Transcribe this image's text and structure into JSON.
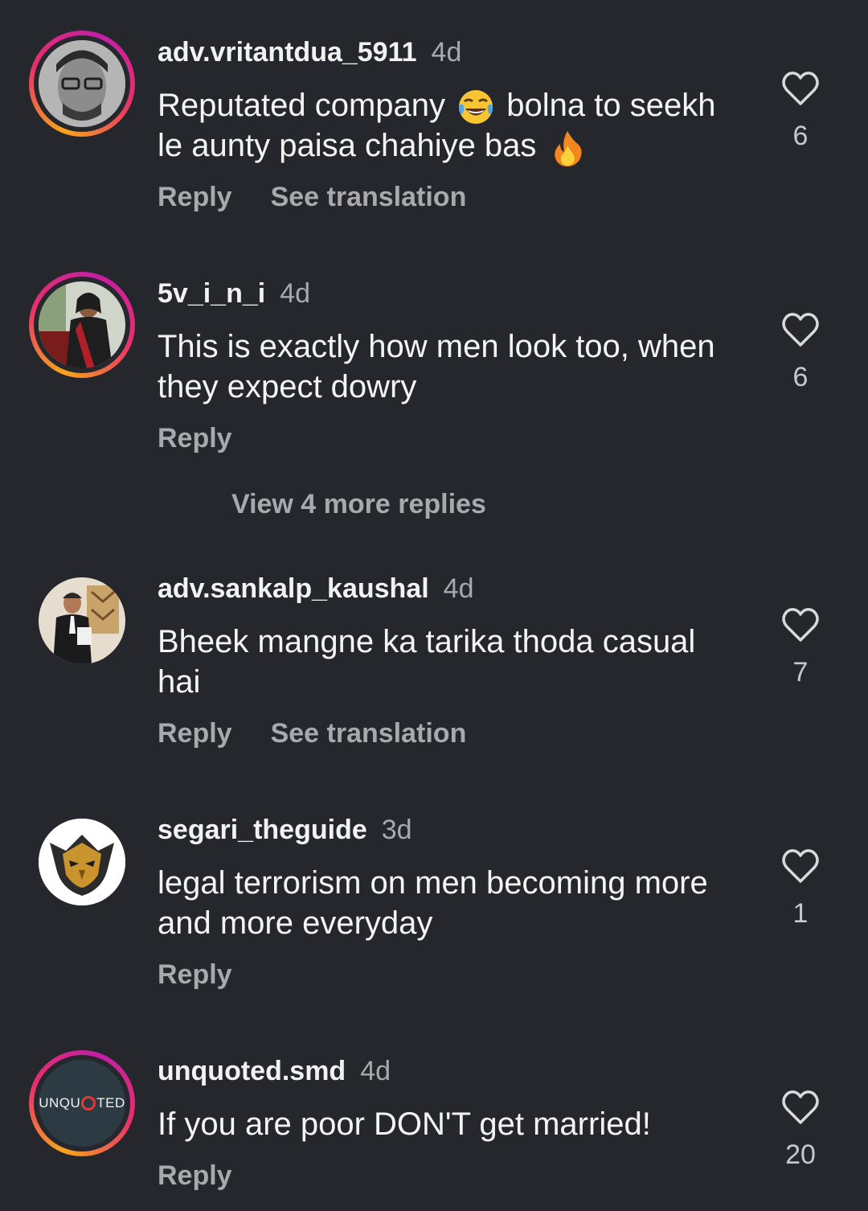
{
  "comments": [
    {
      "username": "adv.vritantdua_5911",
      "time": "4d",
      "text_a": "Reputated company",
      "emoji_a": "face-with-tears-of-joy",
      "text_b": "bolna to seekh le aunty paisa chahiye bas",
      "emoji_b": "fire",
      "reply": "Reply",
      "translate": "See translation",
      "likes": "6"
    },
    {
      "username": "5v_i_n_i",
      "time": "4d",
      "text": "This is exactly how men look too, when they expect dowry",
      "reply": "Reply",
      "likes": "6"
    },
    {
      "username": "adv.sankalp_kaushal",
      "time": "4d",
      "text": "Bheek mangne ka tarika thoda casual hai",
      "reply": "Reply",
      "translate": "See translation",
      "likes": "7"
    },
    {
      "username": "segari_theguide",
      "time": "3d",
      "text": "legal terrorism on men becoming more and more everyday",
      "reply": "Reply",
      "likes": "1"
    },
    {
      "username": "unquoted.smd",
      "time": "4d",
      "text": "If you are poor DON'T get married!",
      "reply": "Reply",
      "likes": "20",
      "avatar_logo_a": "UNQU",
      "avatar_logo_b": "TED"
    }
  ],
  "view_more_replies": "View 4 more replies",
  "colors": {
    "background": "#26272d",
    "secondary_text": "#a8a8ad",
    "story_ring_start": "#f7a51c",
    "story_ring_end": "#c41ea8"
  }
}
